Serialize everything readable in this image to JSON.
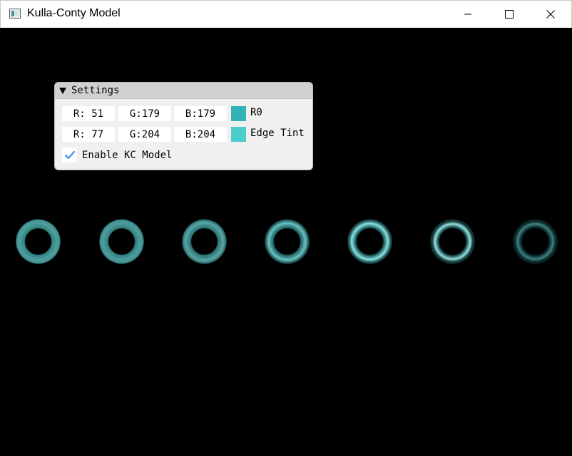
{
  "window": {
    "title": "Kulla-Conty Model"
  },
  "settings": {
    "title": "Settings",
    "r0": {
      "r": "R: 51",
      "g": "G:179",
      "b": "B:179",
      "label": "R0",
      "color": "#33b3b3"
    },
    "edge_tint": {
      "r": "R: 77",
      "g": "G:204",
      "b": "B:204",
      "label": "Edge Tint",
      "color": "#4dcccc"
    },
    "enable_kc": {
      "label": "Enable KC Model",
      "checked": true
    }
  },
  "scene": {
    "tori": [
      {
        "roughness_step": 1,
        "tone": "matte"
      },
      {
        "roughness_step": 2,
        "tone": "matte"
      },
      {
        "roughness_step": 3,
        "tone": "satin"
      },
      {
        "roughness_step": 4,
        "tone": "glossy"
      },
      {
        "roughness_step": 5,
        "tone": "shiny"
      },
      {
        "roughness_step": 6,
        "tone": "metallic"
      },
      {
        "roughness_step": 7,
        "tone": "dark-metallic"
      }
    ]
  }
}
